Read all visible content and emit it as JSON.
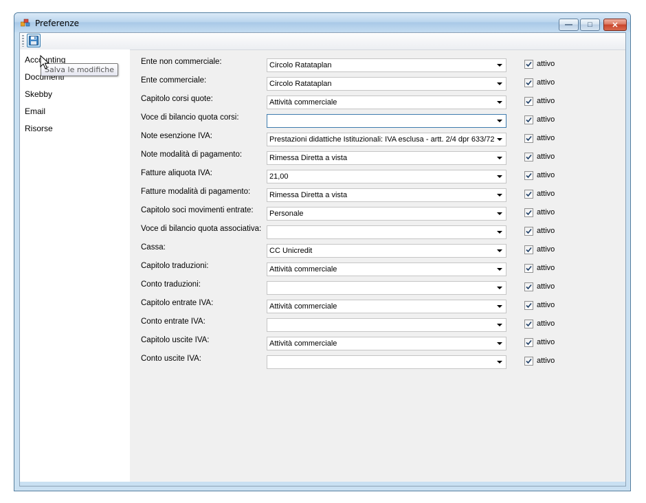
{
  "window": {
    "title": "Preferenze",
    "buttons": {
      "minimize": "—",
      "maximize": "□",
      "close": "✕"
    }
  },
  "toolbar": {
    "save_tooltip": "Salva le modifiche",
    "save_icon": "floppy-disk-icon"
  },
  "sidebar": {
    "items": [
      {
        "label": "Accounting"
      },
      {
        "label": "Documenti"
      },
      {
        "label": "Skebby"
      },
      {
        "label": "Email"
      },
      {
        "label": "Risorse"
      }
    ]
  },
  "form": {
    "checkbox_label": "attivo",
    "rows": [
      {
        "label": "Ente non commerciale:",
        "value": "Circolo Ratataplan",
        "checked": true
      },
      {
        "label": "Ente commerciale:",
        "value": "Circolo Ratataplan",
        "checked": true
      },
      {
        "label": "Capitolo corsi quote:",
        "value": "Attività commerciale",
        "checked": true
      },
      {
        "label": "Voce di bilancio quota corsi:",
        "value": "",
        "checked": true
      },
      {
        "label": "Note esenzione IVA:",
        "value": "Prestazioni didattiche Istituzionali: IVA esclusa - artt. 2/4 dpr 633/72",
        "checked": true
      },
      {
        "label": "Note modalità di pagamento:",
        "value": "Rimessa Diretta a vista",
        "checked": true
      },
      {
        "label": "Fatture aliquota IVA:",
        "value": "21,00",
        "checked": true
      },
      {
        "label": "Fatture modalità di pagamento:",
        "value": "Rimessa Diretta a vista",
        "checked": true
      },
      {
        "label": "Capitolo soci movimenti entrate:",
        "value": "Personale",
        "checked": true
      },
      {
        "label": "Voce di bilancio quota associativa:",
        "value": "",
        "checked": true
      },
      {
        "label": "Cassa:",
        "value": "CC Unicredit",
        "checked": true
      },
      {
        "label": "Capitolo traduzioni:",
        "value": "Attività commerciale",
        "checked": true
      },
      {
        "label": "Conto traduzioni:",
        "value": "",
        "checked": true
      },
      {
        "label": "Capitolo entrate IVA:",
        "value": "Attività commerciale",
        "checked": true
      },
      {
        "label": "Conto entrate IVA:",
        "value": "",
        "checked": true
      },
      {
        "label": "Capitolo uscite IVA:",
        "value": "Attività commerciale",
        "checked": true
      },
      {
        "label": "Conto uscite IVA:",
        "value": "",
        "checked": true
      }
    ]
  },
  "colors": {
    "title_bar": "#bcd6ee",
    "client_bg": "#f0f0f0",
    "close_button": "#c8442a"
  }
}
